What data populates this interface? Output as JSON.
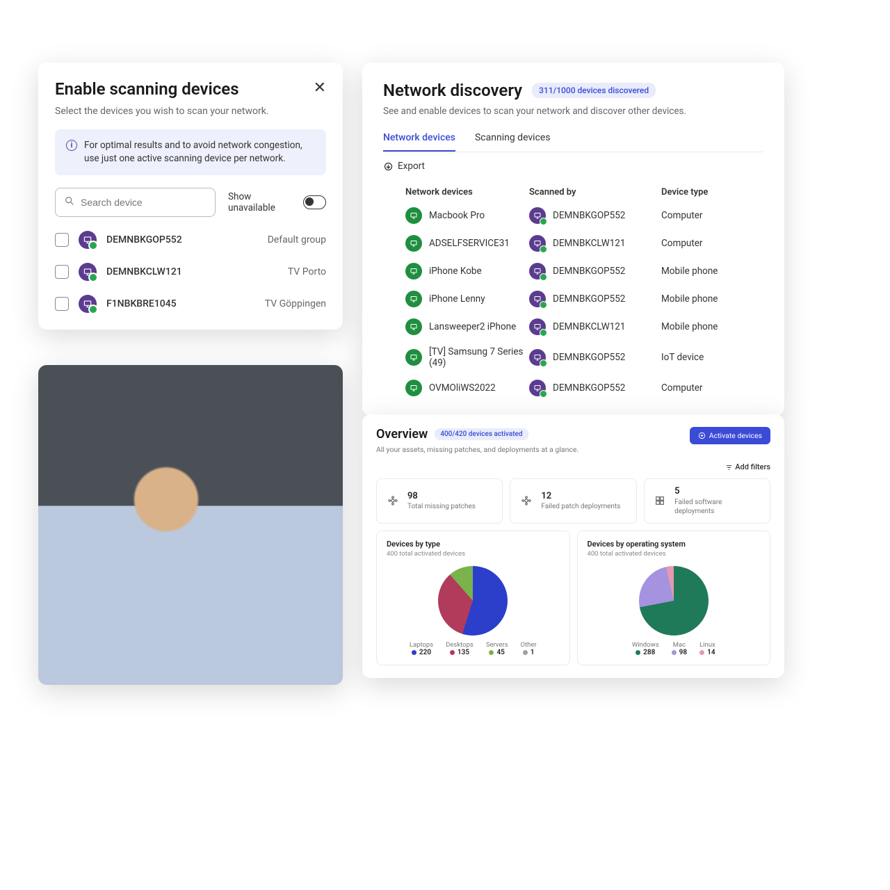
{
  "scan": {
    "title": "Enable scanning devices",
    "sub": "Select the devices you wish to scan your network.",
    "info": "For optimal results and to avoid network congestion, use just one active scanning device per network.",
    "search_placeholder": "Search device",
    "show_unavail": "Show unavailable",
    "items": [
      {
        "name": "DEMNBKGOP552",
        "group": "Default group"
      },
      {
        "name": "DEMNBKCLW121",
        "group": "TV Porto"
      },
      {
        "name": "F1NBKBRE1045",
        "group": "TV Göppingen"
      }
    ]
  },
  "net": {
    "title": "Network discovery",
    "badge": "311/1000 devices discovered",
    "sub": "See and enable devices to scan your network and discover other devices.",
    "tabs": [
      "Network devices",
      "Scanning devices"
    ],
    "export": "Export",
    "headers": {
      "dev": "Network devices",
      "scan": "Scanned by",
      "type": "Device type"
    },
    "rows": [
      {
        "dev": "Macbook Pro",
        "scan": "DEMNBKGOP552",
        "type": "Computer"
      },
      {
        "dev": "ADSELFSERVICE31",
        "scan": "DEMNBKCLW121",
        "type": "Computer"
      },
      {
        "dev": "iPhone Kobe",
        "scan": "DEMNBKGOP552",
        "type": "Mobile phone"
      },
      {
        "dev": "iPhone Lenny",
        "scan": "DEMNBKGOP552",
        "type": "Mobile phone"
      },
      {
        "dev": "Lansweeper2 iPhone",
        "scan": "DEMNBKCLW121",
        "type": "Mobile phone"
      },
      {
        "dev": "[TV] Samsung 7 Series (49)",
        "scan": "DEMNBKGOP552",
        "type": "IoT device"
      },
      {
        "dev": "OVMOliWS2022",
        "scan": "DEMNBKGOP552",
        "type": "Computer"
      }
    ]
  },
  "ov": {
    "title": "Overview",
    "badge": "400/420 devices activated",
    "sub": "All your assets, missing patches, and deployments at a glance.",
    "activate": "Activate devices",
    "filters": "Add filters",
    "stats": [
      {
        "num": "98",
        "lab": "Total missing patches"
      },
      {
        "num": "12",
        "lab": "Failed patch deployments"
      },
      {
        "num": "5",
        "lab": "Failed software deployments"
      }
    ],
    "chart1": {
      "title": "Devices by type",
      "sub": "400 total activated devices",
      "legend": [
        {
          "lab": "Laptops",
          "val": "220",
          "color": "#2b3fcb"
        },
        {
          "lab": "Desktops",
          "val": "135",
          "color": "#b23a5b"
        },
        {
          "lab": "Servers",
          "val": "45",
          "color": "#7ab24b"
        },
        {
          "lab": "Other",
          "val": "1",
          "color": "#9aa0a6"
        }
      ]
    },
    "chart2": {
      "title": "Devices by operating system",
      "sub": "400 total activated devices",
      "legend": [
        {
          "lab": "Windows",
          "val": "288",
          "color": "#1f7a5a"
        },
        {
          "lab": "Mac",
          "val": "98",
          "color": "#a593e0"
        },
        {
          "lab": "Linux",
          "val": "14",
          "color": "#e79aae"
        }
      ]
    }
  },
  "chart_data": [
    {
      "type": "pie",
      "title": "Devices by type",
      "categories": [
        "Laptops",
        "Desktops",
        "Servers",
        "Other"
      ],
      "values": [
        220,
        135,
        45,
        1
      ],
      "colors": [
        "#2b3fcb",
        "#b23a5b",
        "#7ab24b",
        "#9aa0a6"
      ]
    },
    {
      "type": "pie",
      "title": "Devices by operating system",
      "categories": [
        "Windows",
        "Mac",
        "Linux"
      ],
      "values": [
        288,
        98,
        14
      ],
      "colors": [
        "#1f7a5a",
        "#a593e0",
        "#e79aae"
      ]
    }
  ]
}
